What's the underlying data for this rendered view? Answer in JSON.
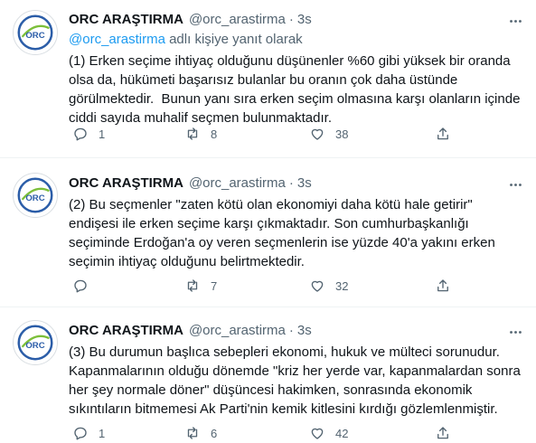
{
  "colors": {
    "accent": "#1d9bf0",
    "muted": "#536471",
    "text": "#0f1419",
    "logo_blue": "#2b5da8",
    "logo_green": "#7cbf3a"
  },
  "avatar_text": "ORC",
  "tweets": [
    {
      "name": "ORC ARAŞTIRMA",
      "handle": "@orc_arastirma",
      "dot": "·",
      "time": "3s",
      "reply_mention": "@orc_arastirma",
      "reply_suffix": " adlı kişiye yanıt olarak",
      "text": "(1) Erken seçime ihtiyaç olduğunu düşünenler %60 gibi yüksek bir oranda olsa da, hükümeti başarısız bulanlar bu oranın çok daha üstünde görülmektedir.  Bunun yanı sıra erken seçim olmasına karşı olanların içinde ciddi sayıda muhalif seçmen bulunmaktadır.",
      "replies": "1",
      "retweets": "8",
      "likes": "38"
    },
    {
      "name": "ORC ARAŞTIRMA",
      "handle": "@orc_arastirma",
      "dot": "·",
      "time": "3s",
      "text": "(2) Bu seçmenler \"zaten kötü olan ekonomiyi daha kötü hale getirir\" endişesi ile erken seçime karşı çıkmaktadır. Son cumhurbaşkanlığı seçiminde Erdoğan'a oy veren seçmenlerin ise yüzde 40'a yakını erken seçimin ihtiyaç olduğunu belirtmektedir.",
      "replies": "",
      "retweets": "7",
      "likes": "32"
    },
    {
      "name": "ORC ARAŞTIRMA",
      "handle": "@orc_arastirma",
      "dot": "·",
      "time": "3s",
      "text": "(3) Bu durumun başlıca sebepleri ekonomi, hukuk ve mülteci sorunudur. Kapanmalarının olduğu dönemde \"kriz her yerde var, kapanmalardan sonra her şey normale döner\" düşüncesi hakimken, sonrasında ekonomik sıkıntıların bitmemesi Ak Parti'nin kemik kitlesini kırdığı gözlemlenmiştir.",
      "replies": "1",
      "retweets": "6",
      "likes": "42"
    }
  ]
}
